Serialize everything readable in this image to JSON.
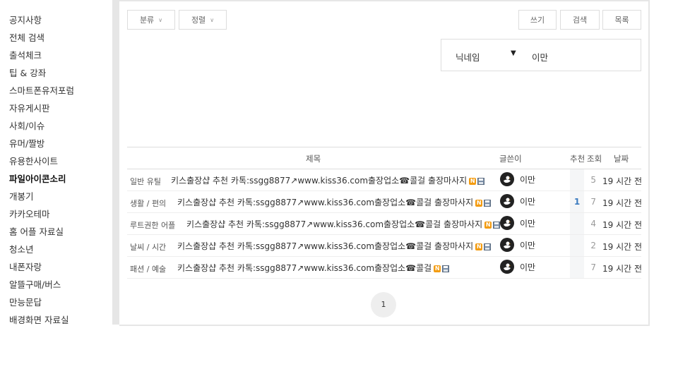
{
  "sidebar": {
    "items": [
      {
        "label": "공지사항"
      },
      {
        "label": "전체 검색"
      },
      {
        "label": "출석체크"
      },
      {
        "label": "팁 & 강좌"
      },
      {
        "label": "스마트폰유저포럼"
      },
      {
        "label": "자유게시판"
      },
      {
        "label": "사회/이슈"
      },
      {
        "label": "유머/짤방"
      },
      {
        "label": "유용한사이트"
      },
      {
        "label": "파일아이콘소리",
        "active": true
      },
      {
        "label": "개봉기"
      },
      {
        "label": "카카오테마"
      },
      {
        "label": "홈 어플 자료실"
      },
      {
        "label": "청소년"
      },
      {
        "label": "내폰자랑"
      },
      {
        "label": "알뜰구매/버스"
      },
      {
        "label": "만능문답"
      },
      {
        "label": "배경화면 자료실"
      }
    ]
  },
  "toolbar": {
    "category_label": "분류",
    "sort_label": "정렬",
    "write_label": "쓰기",
    "search_label": "검색",
    "list_label": "목록"
  },
  "search": {
    "field_label": "닉네임",
    "value": "이만"
  },
  "table": {
    "headers": {
      "title": "제목",
      "author": "글쓴이",
      "recommend": "추천",
      "views": "조회",
      "date": "날짜"
    },
    "rows": [
      {
        "category": "일반 유틸",
        "title": "키스출장샵 추천 카톡:ssgg8877↗www.kiss36.com출장업소☎콜걸 출장마사지",
        "author": "이만",
        "recommend": "",
        "views": "5",
        "date": "19 시간 전"
      },
      {
        "category": "생활 / 편의",
        "title": "키스출장샵 추천 카톡:ssgg8877↗www.kiss36.com출장업소☎콜걸 출장마사지",
        "author": "이만",
        "recommend": "1",
        "views": "7",
        "date": "19 시간 전"
      },
      {
        "category": "루트권한 어플",
        "title": "키스출장샵 추천 카톡:ssgg8877↗www.kiss36.com출장업소☎콜걸 출장마사지",
        "author": "이만",
        "recommend": "",
        "views": "4",
        "date": "19 시간 전"
      },
      {
        "category": "날씨 / 시간",
        "title": "키스출장샵 추천 카톡:ssgg8877↗www.kiss36.com출장업소☎콜걸 출장마사지",
        "author": "이만",
        "recommend": "",
        "views": "2",
        "date": "19 시간 전"
      },
      {
        "category": "패션 / 예술",
        "title": "키스출장샵 추천 카톡:ssgg8877↗www.kiss36.com출장업소☎콜걸",
        "author": "이만",
        "recommend": "",
        "views": "7",
        "date": "19 시간 전"
      }
    ]
  },
  "pagination": {
    "current": "1"
  },
  "icons": {
    "new_badge": "new-badge-icon",
    "file": "file-icon",
    "avatar": "duck-avatar-icon",
    "dropdown": "chevron-down-icon"
  },
  "colors": {
    "accent": "#3b7bbf",
    "new_badge": "#f39c12",
    "gutter": "#e6e6e6"
  }
}
